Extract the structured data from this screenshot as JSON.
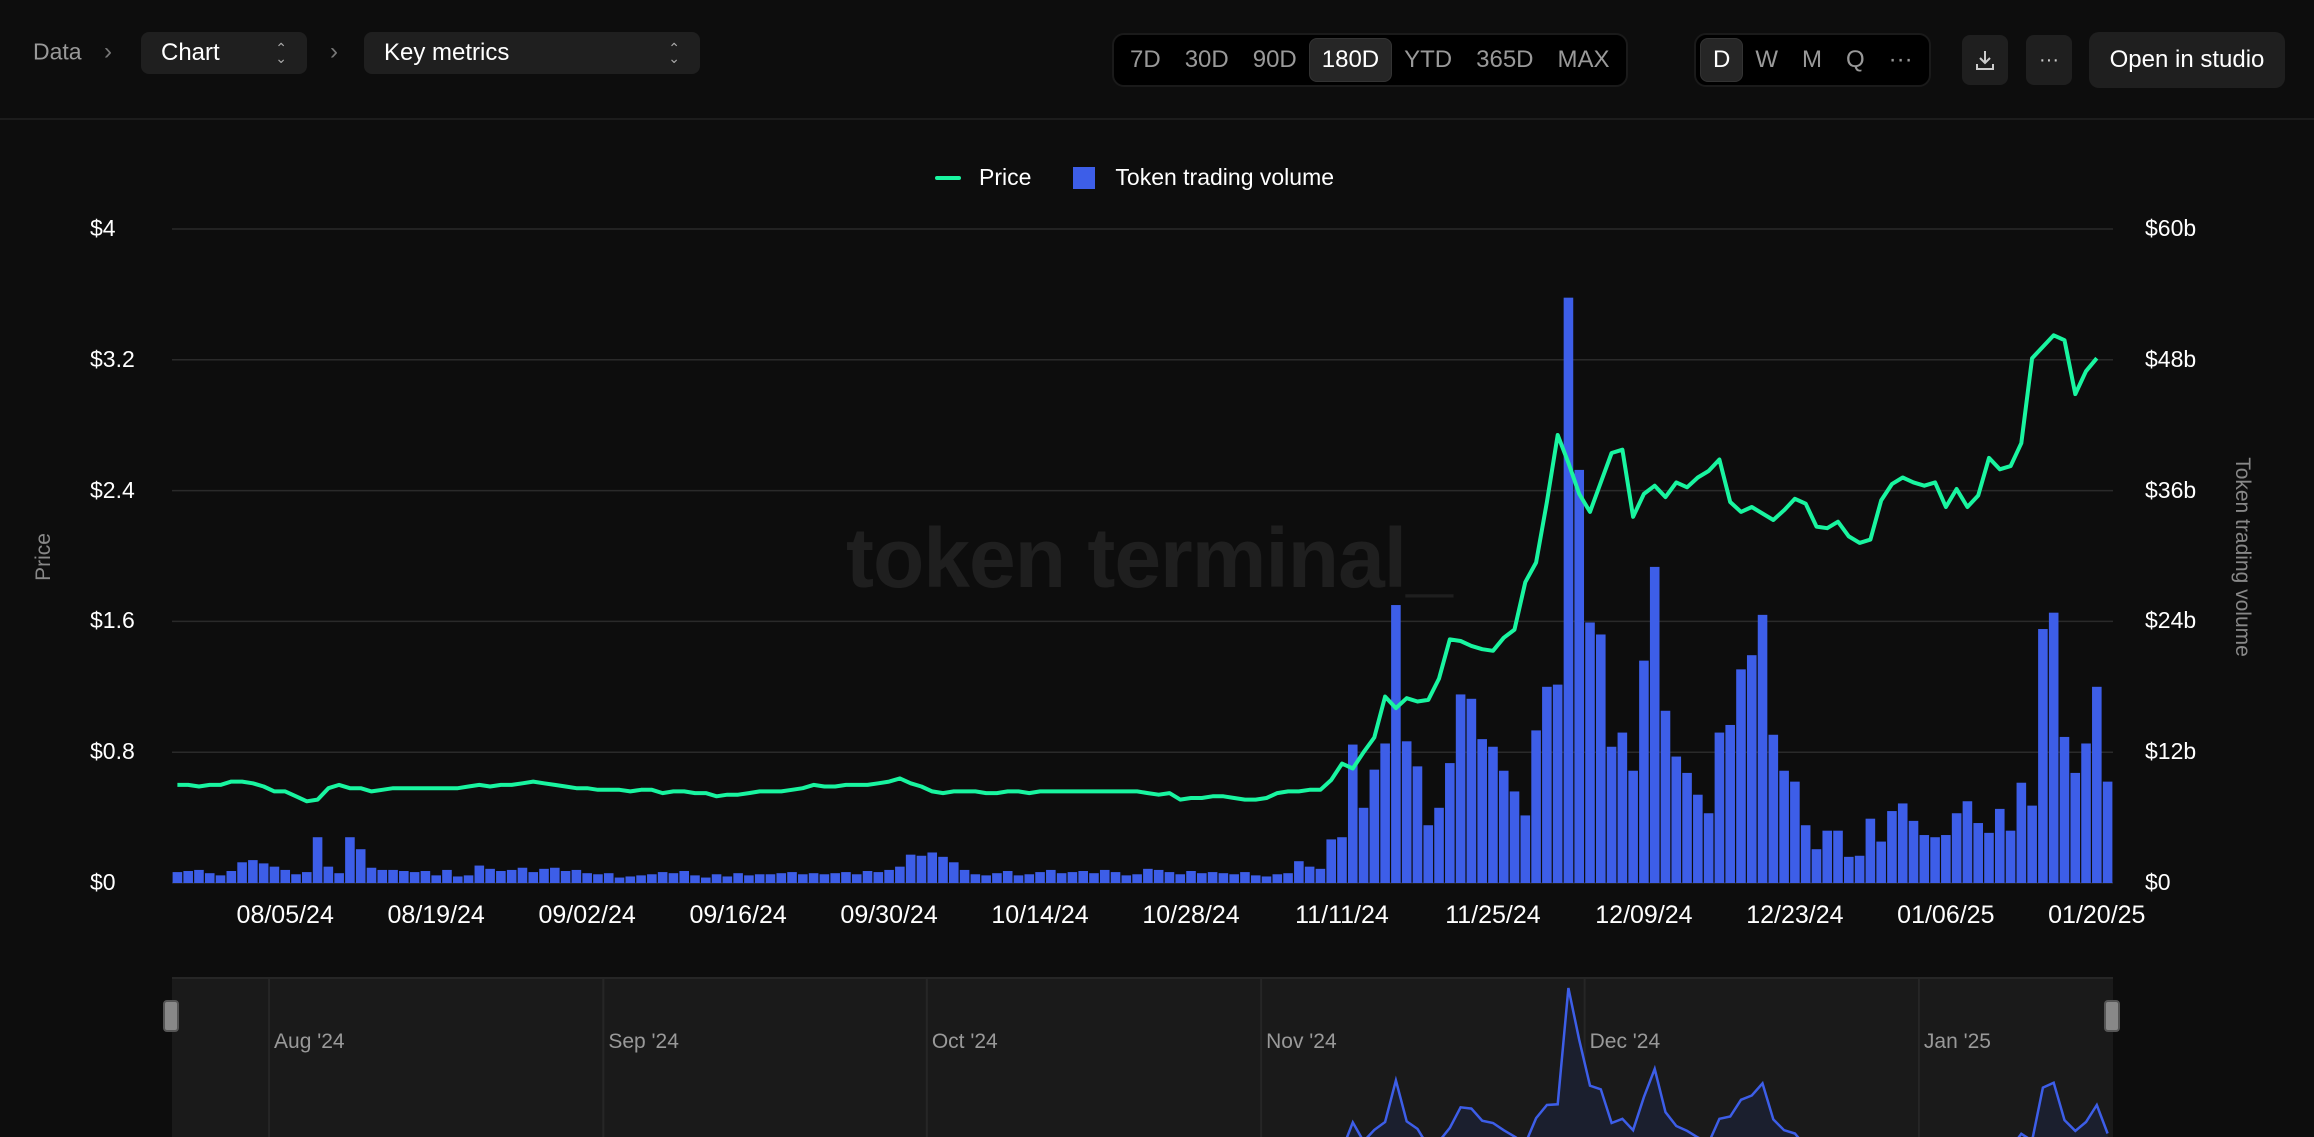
{
  "breadcrumb": {
    "root": "Data",
    "chart_select": "Chart",
    "metric_select": "Key metrics"
  },
  "toolbar": {
    "ranges": [
      "7D",
      "30D",
      "90D",
      "180D",
      "YTD",
      "365D",
      "MAX"
    ],
    "active_range": "180D",
    "intervals": [
      "D",
      "W",
      "M",
      "Q",
      "···"
    ],
    "active_interval": "D",
    "more_label": "···",
    "open_studio": "Open in studio"
  },
  "watermark": "token terminal_",
  "navigator": {
    "months": [
      "Aug '24",
      "Sep '24",
      "Oct '24",
      "Nov '24",
      "Dec '24",
      "Jan '25"
    ]
  },
  "colors": {
    "price": "#19f5a0",
    "volume": "#3d5ee8",
    "grid": "#2a2a2a"
  },
  "chart_data": {
    "type": "bar+line",
    "start_date": "07/23/24",
    "legend": [
      "Price",
      "Token trading volume"
    ],
    "ylabel_left": "Price",
    "ylabel_right": "Token trading volume",
    "yticks_left": [
      "$0",
      "$0.8",
      "$1.6",
      "$2.4",
      "$3.2",
      "$4"
    ],
    "ylim_left": [
      0,
      4
    ],
    "yticks_right": [
      "$0",
      "$12b",
      "$24b",
      "$36b",
      "$48b",
      "$60b"
    ],
    "ylim_right": [
      0,
      60
    ],
    "xticks": [
      {
        "i": 10,
        "label": "08/05/24"
      },
      {
        "i": 24,
        "label": "08/19/24"
      },
      {
        "i": 38,
        "label": "09/02/24"
      },
      {
        "i": 52,
        "label": "09/16/24"
      },
      {
        "i": 66,
        "label": "09/30/24"
      },
      {
        "i": 80,
        "label": "10/14/24"
      },
      {
        "i": 94,
        "label": "10/28/24"
      },
      {
        "i": 108,
        "label": "11/11/24"
      },
      {
        "i": 122,
        "label": "11/25/24"
      },
      {
        "i": 136,
        "label": "12/09/24"
      },
      {
        "i": 150,
        "label": "12/23/24"
      },
      {
        "i": 164,
        "label": "01/06/25"
      },
      {
        "i": 178,
        "label": "01/20/25"
      }
    ],
    "volume_b": [
      1.0,
      1.1,
      1.2,
      0.9,
      0.7,
      1.1,
      1.9,
      2.1,
      1.8,
      1.5,
      1.2,
      0.8,
      1.0,
      4.2,
      1.5,
      0.9,
      4.2,
      3.1,
      1.4,
      1.2,
      1.2,
      1.1,
      1.0,
      1.1,
      0.7,
      1.2,
      0.6,
      0.7,
      1.6,
      1.3,
      1.1,
      1.2,
      1.4,
      1.0,
      1.3,
      1.4,
      1.1,
      1.2,
      0.9,
      0.8,
      0.9,
      0.5,
      0.6,
      0.7,
      0.8,
      1.0,
      0.9,
      1.1,
      0.7,
      0.5,
      0.8,
      0.6,
      0.9,
      0.7,
      0.8,
      0.8,
      0.9,
      1.0,
      0.8,
      0.9,
      0.8,
      0.9,
      1.0,
      0.8,
      1.1,
      1.0,
      1.2,
      1.5,
      2.6,
      2.5,
      2.8,
      2.4,
      1.9,
      1.2,
      0.8,
      0.7,
      0.9,
      1.1,
      0.7,
      0.8,
      1.0,
      1.2,
      0.9,
      1.0,
      1.1,
      0.9,
      1.2,
      1.0,
      0.7,
      0.8,
      1.3,
      1.2,
      1.0,
      0.8,
      1.1,
      0.9,
      1.0,
      0.9,
      0.8,
      1.0,
      0.7,
      0.6,
      0.8,
      0.9,
      2.0,
      1.5,
      1.3,
      4.0,
      4.2,
      12.7,
      6.9,
      10.4,
      12.8,
      25.5,
      13.0,
      10.7,
      5.3,
      6.9,
      11.0,
      17.3,
      16.9,
      13.2,
      12.5,
      10.3,
      8.4,
      6.2,
      14.0,
      18.0,
      18.2,
      53.7,
      37.9,
      23.9,
      22.8,
      12.5,
      13.8,
      10.3,
      20.4,
      29.0,
      15.8,
      11.6,
      10.1,
      8.1,
      6.4,
      13.8,
      14.5,
      19.6,
      20.9,
      24.6,
      13.6,
      10.3,
      9.3,
      5.3,
      3.1,
      4.8,
      4.8,
      2.4,
      2.5,
      5.9,
      3.8,
      6.6,
      7.3,
      5.7,
      4.4,
      4.2,
      4.4,
      6.4,
      7.5,
      5.5,
      4.6,
      6.8,
      4.8,
      9.2,
      7.1,
      23.3,
      24.8,
      13.4,
      10.1,
      12.8,
      18.0,
      9.3
    ],
    "price_usd": [
      0.6,
      0.6,
      0.59,
      0.6,
      0.6,
      0.62,
      0.62,
      0.61,
      0.59,
      0.56,
      0.56,
      0.53,
      0.5,
      0.51,
      0.58,
      0.6,
      0.58,
      0.58,
      0.56,
      0.57,
      0.58,
      0.58,
      0.58,
      0.58,
      0.58,
      0.58,
      0.58,
      0.59,
      0.6,
      0.59,
      0.6,
      0.6,
      0.61,
      0.62,
      0.61,
      0.6,
      0.59,
      0.58,
      0.58,
      0.57,
      0.57,
      0.57,
      0.56,
      0.57,
      0.57,
      0.55,
      0.56,
      0.56,
      0.55,
      0.55,
      0.53,
      0.54,
      0.54,
      0.55,
      0.56,
      0.56,
      0.56,
      0.57,
      0.58,
      0.6,
      0.59,
      0.59,
      0.6,
      0.6,
      0.6,
      0.61,
      0.62,
      0.64,
      0.61,
      0.59,
      0.56,
      0.55,
      0.56,
      0.56,
      0.56,
      0.55,
      0.55,
      0.56,
      0.56,
      0.55,
      0.56,
      0.56,
      0.56,
      0.56,
      0.56,
      0.56,
      0.56,
      0.56,
      0.56,
      0.56,
      0.55,
      0.54,
      0.55,
      0.51,
      0.52,
      0.52,
      0.53,
      0.53,
      0.52,
      0.51,
      0.51,
      0.52,
      0.55,
      0.56,
      0.56,
      0.57,
      0.57,
      0.63,
      0.73,
      0.7,
      0.8,
      0.89,
      1.14,
      1.07,
      1.13,
      1.11,
      1.12,
      1.25,
      1.49,
      1.48,
      1.45,
      1.43,
      1.42,
      1.5,
      1.55,
      1.84,
      1.96,
      2.33,
      2.74,
      2.57,
      2.38,
      2.27,
      2.45,
      2.63,
      2.65,
      2.24,
      2.38,
      2.43,
      2.36,
      2.45,
      2.42,
      2.48,
      2.52,
      2.59,
      2.33,
      2.27,
      2.3,
      2.26,
      2.22,
      2.28,
      2.35,
      2.32,
      2.18,
      2.17,
      2.21,
      2.12,
      2.08,
      2.1,
      2.34,
      2.44,
      2.48,
      2.45,
      2.43,
      2.45,
      2.3,
      2.41,
      2.3,
      2.37,
      2.6,
      2.53,
      2.55,
      2.69,
      3.21,
      3.28,
      3.35,
      3.32,
      2.99,
      3.13,
      3.21
    ]
  }
}
